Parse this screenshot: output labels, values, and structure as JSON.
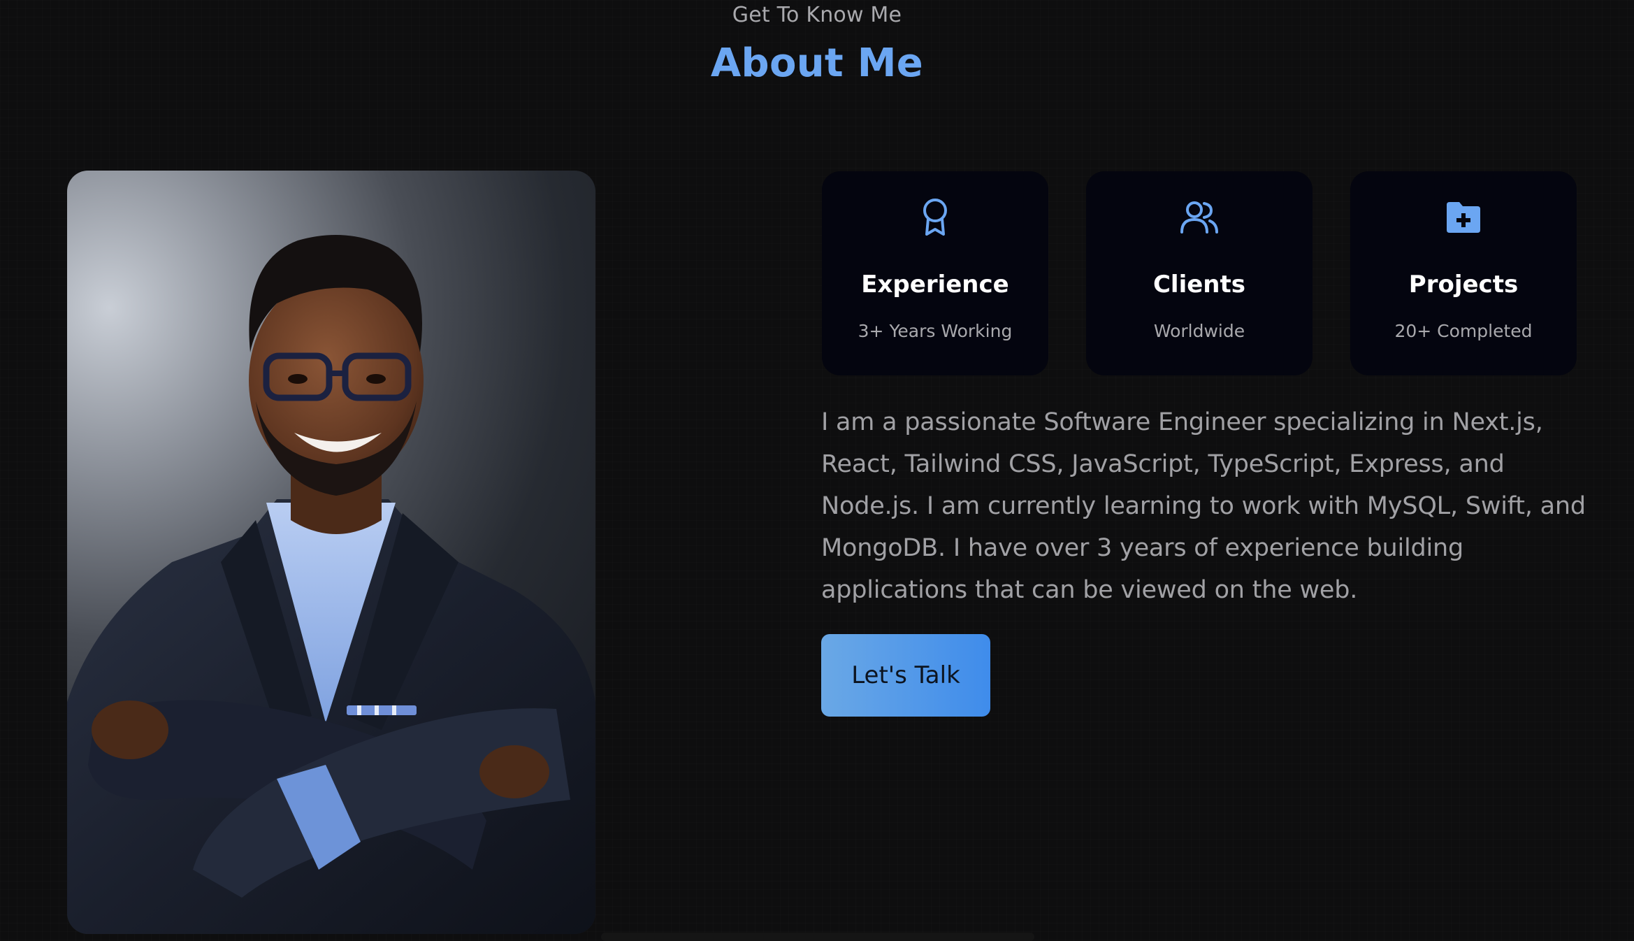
{
  "header": {
    "subtitle": "Get To Know Me",
    "title": "About Me"
  },
  "colors": {
    "accent": "#6ba6f2",
    "card_bg": "#04050f",
    "page_bg": "#0e0e0f",
    "button_gradient_start": "#6aa8e6",
    "button_gradient_end": "#3f8ceb"
  },
  "stats": [
    {
      "icon": "award-icon",
      "title": "Experience",
      "subtitle": "3+ Years Working"
    },
    {
      "icon": "users-icon",
      "title": "Clients",
      "subtitle": "Worldwide"
    },
    {
      "icon": "folder-plus-icon",
      "title": "Projects",
      "subtitle": "20+ Completed"
    }
  ],
  "bio": "I am a passionate Software Engineer specializing in Next.js, React, Tailwind CSS, JavaScript, TypeScript, Express, and Node.js. I am currently learning to work with MySQL, Swift, and MongoDB. I have over 3 years of experience building applications that can be viewed on the web.",
  "cta": {
    "label": "Let's Talk"
  }
}
